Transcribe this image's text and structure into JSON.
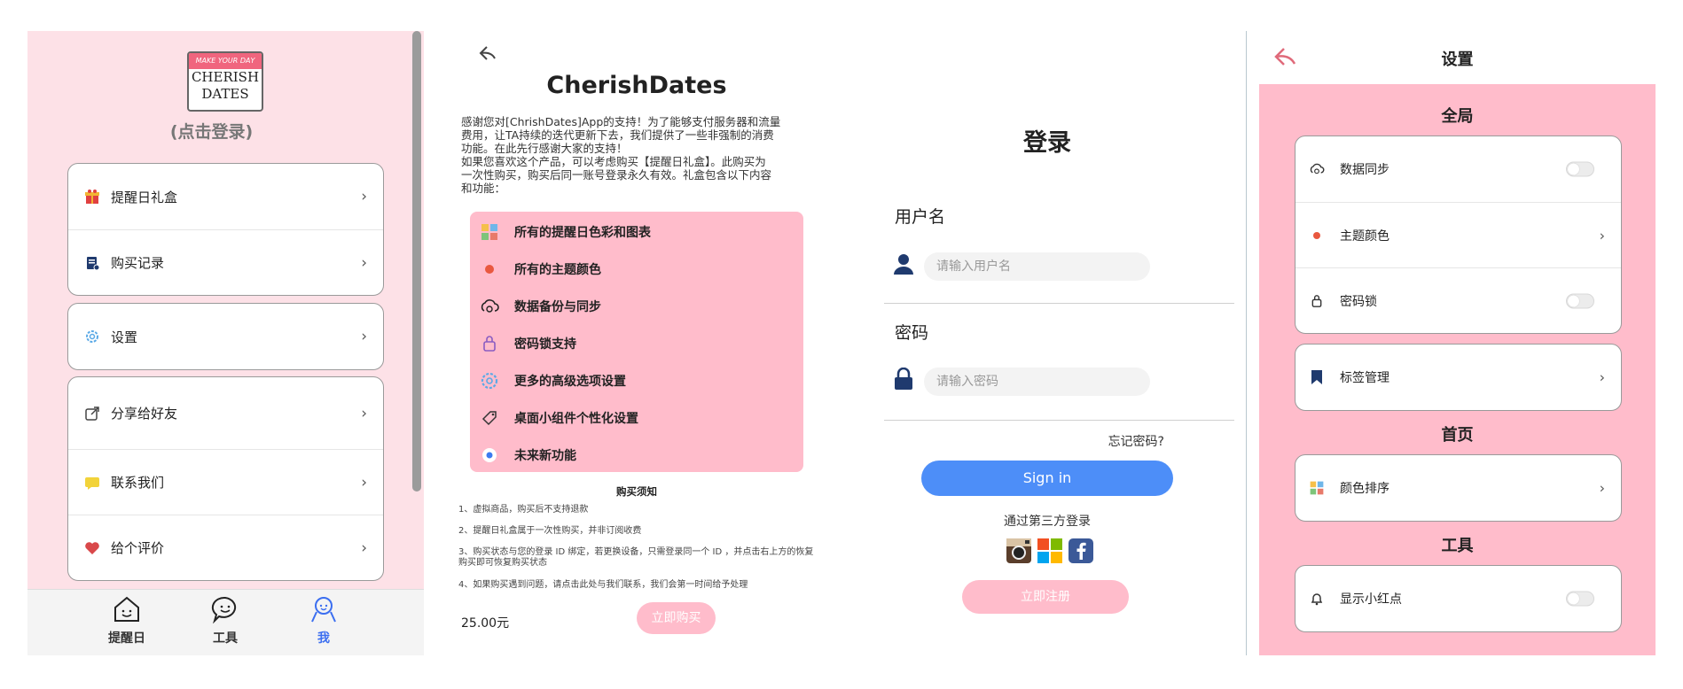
{
  "profile": {
    "logo_band": "MAKE YOUR DAY",
    "logo_line1": "CHERISH",
    "logo_line2": "DATES",
    "login_hint": "(点击登录)",
    "menu_group1": [
      {
        "label": "提醒日礼盒",
        "icon": "gift-icon"
      },
      {
        "label": "购买记录",
        "icon": "receipt-icon"
      }
    ],
    "menu_group2": [
      {
        "label": "设置",
        "icon": "gear-icon"
      }
    ],
    "menu_group3": [
      {
        "label": "分享给好友",
        "icon": "share-icon"
      },
      {
        "label": "联系我们",
        "icon": "chat-icon"
      },
      {
        "label": "给个评价",
        "icon": "heart-icon"
      }
    ],
    "tabs": [
      {
        "label": "提醒日",
        "icon": "house-face-icon",
        "active": false
      },
      {
        "label": "工具",
        "icon": "speech-bubble-face-icon",
        "active": false
      },
      {
        "label": "我",
        "icon": "person-face-icon",
        "active": true
      }
    ]
  },
  "purchase": {
    "title": "CherishDates",
    "intro_lines": [
      "感谢您对[ChrishDates]App的支持！为了能够支付服务器和流量",
      "费用，让TA持续的迭代更新下去，我们提供了一些非强制的消费",
      "功能。在此先行感谢大家的支持！",
      "如果您喜欢这个产品，可以考虑购买【提醒日礼盒】。此购买为",
      "一次性购买，购买后同一账号登录永久有效。礼盒包含以下内容",
      "和功能："
    ],
    "features": [
      {
        "label": "所有的提醒日色彩和图表",
        "icon": "palette-blocks-icon"
      },
      {
        "label": "所有的主题颜色",
        "icon": "paint-dot-icon"
      },
      {
        "label": "数据备份与同步",
        "icon": "cloud-sync-icon"
      },
      {
        "label": "密码锁支持",
        "icon": "lock-icon"
      },
      {
        "label": "更多的高级选项设置",
        "icon": "gear-icon"
      },
      {
        "label": "桌面小组件个性化设置",
        "icon": "tag-icon"
      },
      {
        "label": "未来新功能",
        "icon": "radio-dot-icon"
      }
    ],
    "notice_title": "购买须知",
    "notices": [
      "1、虚拟商品，购买后不支持退款",
      "2、提醒日礼盒属于一次性购买，并非订阅收费",
      "3、购买状态与您的登录 ID 绑定，若更换设备，只需登录同一个 ID ，并点击右上方的恢复购买即可恢复购买状态",
      "4、如果购买遇到问题，请点击此处与我们联系，我们会第一时间给予处理"
    ],
    "price": "25.00元",
    "buy_label": "立即购买"
  },
  "login": {
    "title": "登录",
    "username_label": "用户名",
    "username_placeholder": "请输入用户名",
    "password_label": "密码",
    "password_placeholder": "请输入密码",
    "forgot": "忘记密码?",
    "signin": "Sign in",
    "third_party": "通过第三方登录",
    "register": "立即注册",
    "social": [
      "instagram-icon",
      "microsoft-icon",
      "facebook-icon"
    ]
  },
  "settings": {
    "title": "设置",
    "sections": [
      {
        "title": "全局"
      },
      {
        "title": "首页"
      },
      {
        "title": "工具"
      }
    ],
    "global_items": [
      {
        "label": "数据同步",
        "icon": "cloud-sync-icon",
        "control": "toggle"
      },
      {
        "label": "主题颜色",
        "icon": "paint-dot-icon",
        "control": "chevron"
      },
      {
        "label": "密码锁",
        "icon": "lock-icon",
        "control": "toggle"
      }
    ],
    "tag_item": {
      "label": "标签管理",
      "icon": "bookmark-icon",
      "control": "chevron"
    },
    "home_item": {
      "label": "颜色排序",
      "icon": "palette-blocks-icon",
      "control": "chevron"
    },
    "tool_item": {
      "label": "显示小红点",
      "icon": "bell-icon",
      "control": "toggle"
    }
  },
  "colors": {
    "pink_bg": "#fde1e7",
    "pink_accent": "#ffbccb",
    "blue": "#4d8ef8",
    "active_tab": "#3b6ef0"
  }
}
